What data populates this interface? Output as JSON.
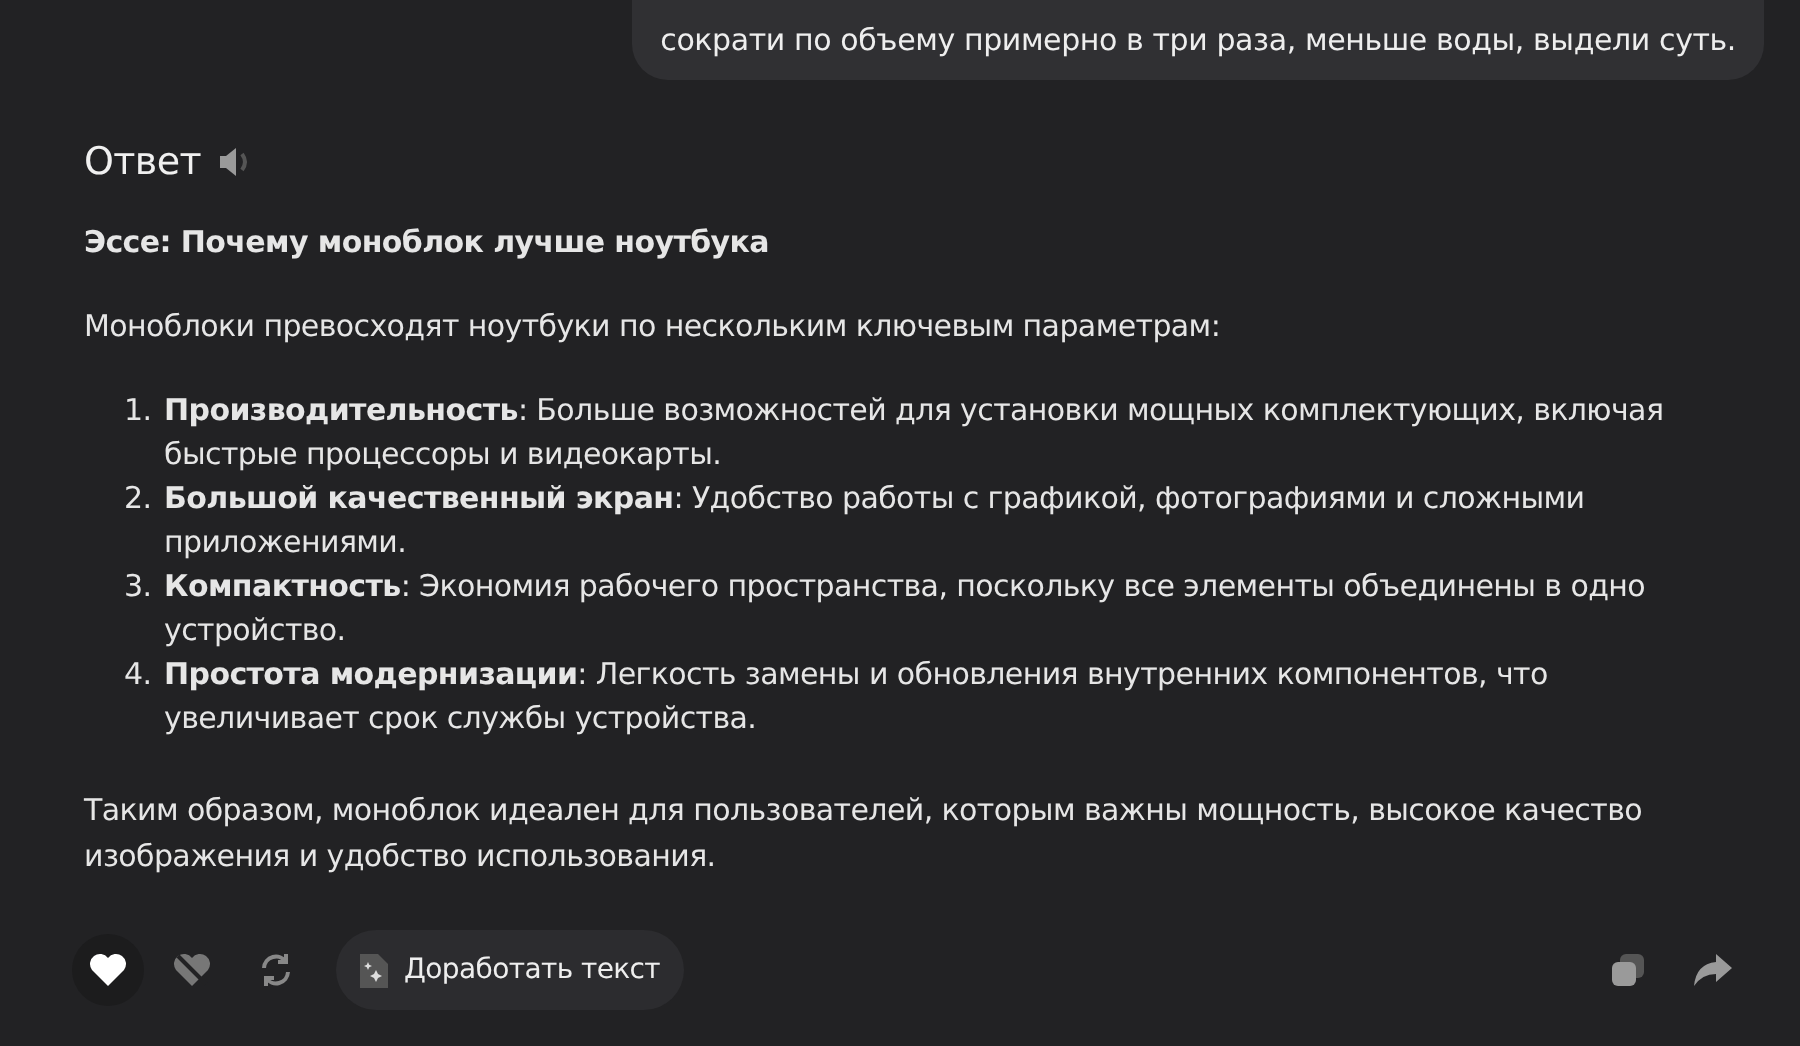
{
  "user_message": "сократи по объему примерно в три раза, меньше воды, выдели суть.",
  "answer": {
    "heading": "Ответ",
    "title": "Эссе: Почему моноблок лучше ноутбука",
    "intro": "Моноблоки превосходят ноутбуки по нескольким ключевым параметрам:",
    "items": [
      {
        "number": "1.",
        "text": "**Производительность**: Больше возможностей для установки мощных комплектующих, включая быстрые процессоры и видеокарты."
      },
      {
        "number": "2.",
        "text": "**Большой качественный экран**: Удобство работы с графикой, фотографиями и сложными приложениями."
      },
      {
        "number": "3.",
        "text": "**Компактность**: Экономия рабочего пространства, поскольку все элементы объединены в одно устройство."
      },
      {
        "number": "4.",
        "text": "**Простота модернизации**: Легкость замены и обновления внутренних компонентов, что увеличивает срок службы устройства."
      }
    ],
    "conclusion": "Таким образом, моноблок идеален для пользователей, которым важны мощность, высокое качество изображения и удобство использования."
  },
  "actions": {
    "liked": true,
    "refine_button": "Доработать текст"
  }
}
